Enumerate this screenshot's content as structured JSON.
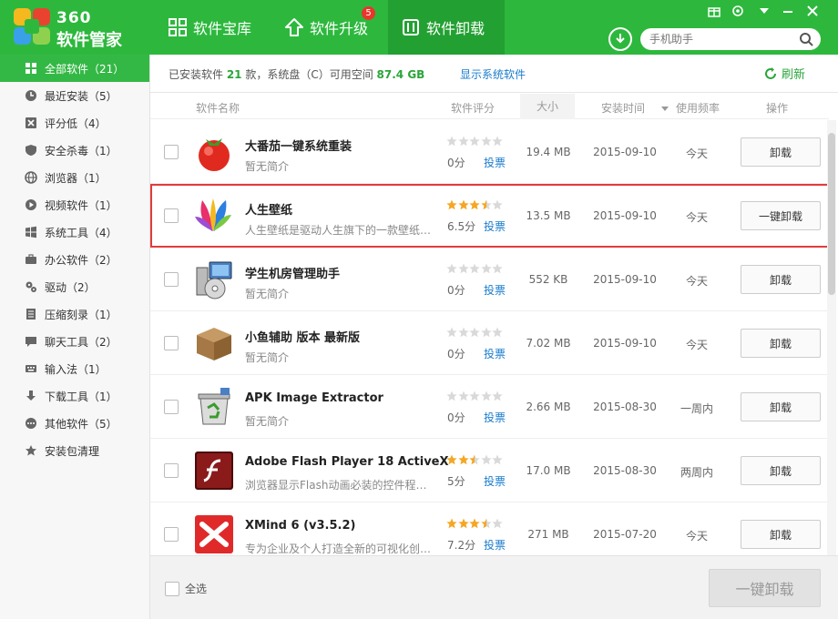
{
  "header": {
    "logo_top": "360",
    "logo_bottom": "软件管家",
    "tabs": [
      {
        "label": "软件宝库",
        "icon": "grid-icon"
      },
      {
        "label": "软件升级",
        "icon": "upgrade-arrow-icon",
        "badge": "5"
      },
      {
        "label": "软件卸载",
        "icon": "trash-icon"
      }
    ],
    "search_placeholder": "手机助手"
  },
  "sidebar": {
    "items": [
      {
        "label": "全部软件（21）",
        "icon": "grid-icon"
      },
      {
        "label": "最近安装（5）",
        "icon": "clock-icon"
      },
      {
        "label": "评分低（4）",
        "icon": "thumbs-down-icon"
      },
      {
        "label": "安全杀毒（1）",
        "icon": "shield-icon"
      },
      {
        "label": "浏览器（1）",
        "icon": "globe-icon"
      },
      {
        "label": "视频软件（1）",
        "icon": "play-icon"
      },
      {
        "label": "系统工具（4）",
        "icon": "windows-icon"
      },
      {
        "label": "办公软件（2）",
        "icon": "briefcase-icon"
      },
      {
        "label": "驱动（2）",
        "icon": "gear-icon"
      },
      {
        "label": "压缩刻录（1）",
        "icon": "archive-icon"
      },
      {
        "label": "聊天工具（2）",
        "icon": "chat-icon"
      },
      {
        "label": "输入法（1）",
        "icon": "keyboard-icon"
      },
      {
        "label": "下载工具（1）",
        "icon": "download-icon"
      },
      {
        "label": "其他软件（5）",
        "icon": "more-icon"
      },
      {
        "label": "安装包清理",
        "icon": "star-icon"
      }
    ]
  },
  "info": {
    "prefix": "已安装软件 ",
    "count": "21",
    "middle": " 款，系统盘（C）可用空间 ",
    "space": "87.4 GB",
    "show_system": "显示系统软件",
    "refresh": "刷新"
  },
  "columns": {
    "name": "软件名称",
    "rating": "软件评分",
    "size": "大小",
    "install_time": "安装时间",
    "frequency": "使用频率",
    "action": "操作"
  },
  "rows": [
    {
      "name": "大番茄一键系统重装",
      "desc": "暂无简介",
      "rating": 0,
      "score": "0分",
      "vote": "投票",
      "size": "19.4 MB",
      "date": "2015-09-10",
      "freq": "今天",
      "button": "卸载",
      "icon": "tomato-icon"
    },
    {
      "name": "人生壁纸",
      "desc": "人生壁纸是驱动人生旗下的一款壁纸…",
      "rating": 3.5,
      "score": "6.5分",
      "vote": "投票",
      "size": "13.5 MB",
      "date": "2015-09-10",
      "freq": "今天",
      "button": "一键卸载",
      "icon": "wallpaper-icon"
    },
    {
      "name": "学生机房管理助手",
      "desc": "暂无简介",
      "rating": 0,
      "score": "0分",
      "vote": "投票",
      "size": "552 KB",
      "date": "2015-09-10",
      "freq": "今天",
      "button": "卸载",
      "icon": "computer-disc-icon"
    },
    {
      "name": "小鱼辅助 版本 最新版",
      "desc": "暂无简介",
      "rating": 0,
      "score": "0分",
      "vote": "投票",
      "size": "7.02 MB",
      "date": "2015-09-10",
      "freq": "今天",
      "button": "卸载",
      "icon": "box-icon"
    },
    {
      "name": "APK Image Extractor",
      "desc": "暂无简介",
      "rating": 0,
      "score": "0分",
      "vote": "投票",
      "size": "2.66 MB",
      "date": "2015-08-30",
      "freq": "一周内",
      "button": "卸载",
      "icon": "recycle-bin-icon"
    },
    {
      "name": "Adobe Flash Player 18 ActiveX",
      "desc": "浏览器显示Flash动画必装的控件程序…",
      "rating": 2.5,
      "score": "5分",
      "vote": "投票",
      "size": "17.0 MB",
      "date": "2015-08-30",
      "freq": "两周内",
      "button": "卸载",
      "icon": "flash-icon"
    },
    {
      "name": "XMind 6 (v3.5.2)",
      "desc": "专为企业及个人打造全新的可视化创…",
      "rating": 3.5,
      "score": "7.2分",
      "vote": "投票",
      "size": "271 MB",
      "date": "2015-07-20",
      "freq": "今天",
      "button": "卸载",
      "icon": "xmind-icon"
    }
  ],
  "footer": {
    "select_all": "全选",
    "bulk_uninstall": "一键卸载"
  }
}
